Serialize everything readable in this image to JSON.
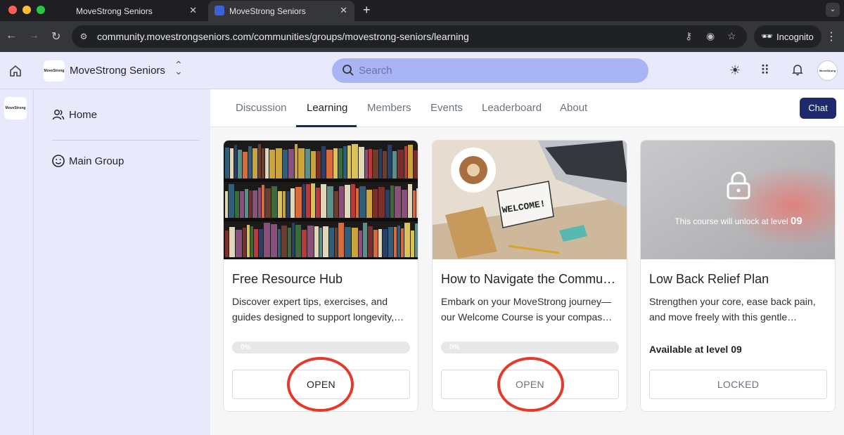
{
  "browser": {
    "tabs": [
      {
        "title": "MoveStrong Seniors",
        "active": false
      },
      {
        "title": "MoveStrong Seniors",
        "active": true
      }
    ],
    "url": "community.movestrongseniors.com/communities/groups/movestrong-seniors/learning",
    "incognito_label": "Incognito"
  },
  "header": {
    "brand_name": "MoveStrong Seniors",
    "logo_text": "MoveStrong",
    "search_placeholder": "Search",
    "avatar_text": "MoveStrong"
  },
  "rail": {
    "logo_text": "MoveStrong"
  },
  "sidebar": {
    "items": [
      {
        "label": "Home",
        "icon": "users-icon"
      },
      {
        "label": "Main Group",
        "icon": "smiley-icon"
      }
    ]
  },
  "group_tabs": [
    {
      "label": "Discussion",
      "active": false
    },
    {
      "label": "Learning",
      "active": true
    },
    {
      "label": "Members",
      "active": false
    },
    {
      "label": "Events",
      "active": false
    },
    {
      "label": "Leaderboard",
      "active": false
    },
    {
      "label": "About",
      "active": false
    }
  ],
  "chat_label": "Chat",
  "courses": [
    {
      "title": "Free Resource Hub",
      "desc_line1": "Discover expert tips, exercises, and",
      "desc_line2": "guides designed to support longevity,…",
      "progress_label": "0%",
      "progress": 0,
      "button": "OPEN",
      "image": "bookshelf"
    },
    {
      "title": "How to Navigate the Commu…",
      "desc_line1": "Embark on your MoveStrong journey—",
      "desc_line2": "our Welcome Course is your compas…",
      "progress_label": "0%",
      "progress": 0,
      "button": "OPEN",
      "image": "welcome-desk",
      "image_sign": "WELCOME!"
    },
    {
      "title": "Low Back Relief Plan",
      "desc_line1": "Strengthen your core, ease back pain,",
      "desc_line2": "and move freely with this gentle…",
      "lock_text": "This course will unlock at level",
      "lock_level": "09",
      "available": "Available at level 09",
      "button": "LOCKED",
      "image": "locked-blur"
    }
  ],
  "colors": {
    "brand_bg": "#e8eafc",
    "search_bg": "#a9b4f5",
    "chat_bg": "#1e2a6b",
    "annotation": "#e53a2b"
  }
}
